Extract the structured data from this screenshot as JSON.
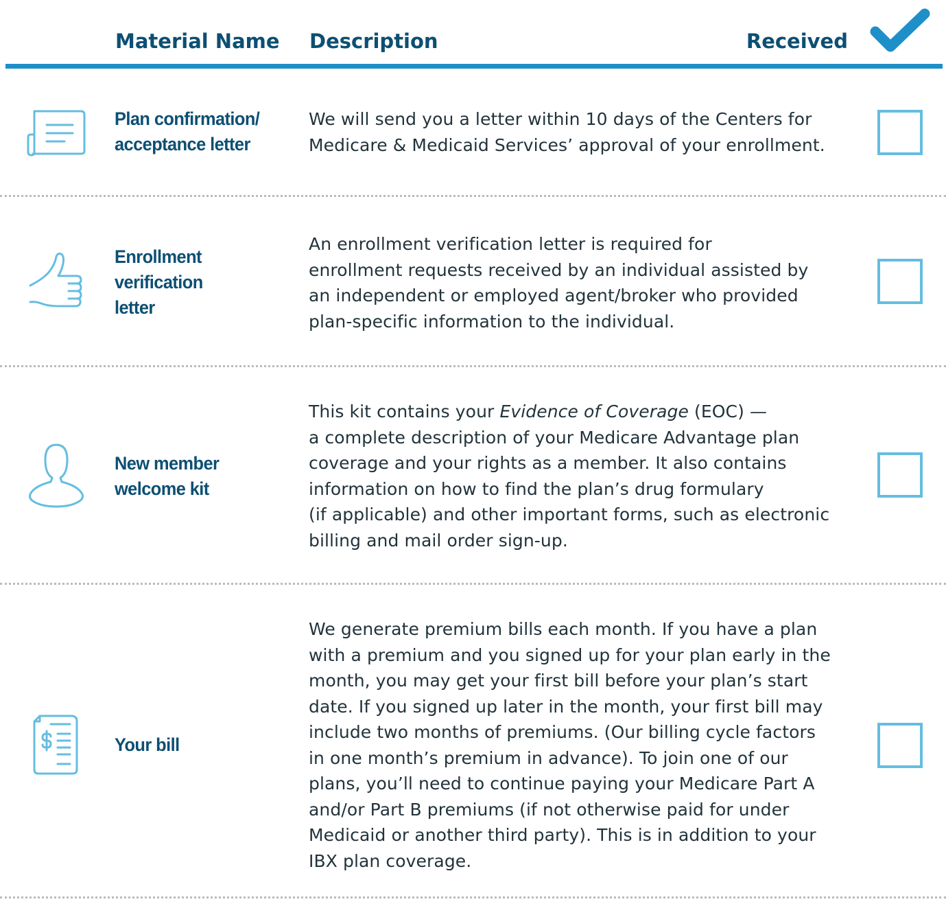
{
  "header": {
    "material_name": "Material Name",
    "description": "Description",
    "received": "Received",
    "check_icon": "checkmark-icon",
    "accent_color": "#1e8fc9",
    "heading_color": "#0c4f73"
  },
  "rows": [
    {
      "icon": "letter-icon",
      "name_lines": [
        "Plan confirmation/",
        "acceptance letter"
      ],
      "description_lines": [
        "We will send you a letter within 10 days of the Centers for",
        "Medicare & Medicaid Services’ approval of your enrollment."
      ],
      "received": false
    },
    {
      "icon": "thumbs-up-icon",
      "name_lines": [
        "Enrollment",
        "verification",
        "letter"
      ],
      "description_lines": [
        "An enrollment verification letter is required for",
        "enrollment requests received by an individual assisted by",
        "an independent or employed agent/broker who provided",
        "plan-specific information to the individual."
      ],
      "received": false
    },
    {
      "icon": "person-icon",
      "name_lines": [
        "New member",
        "welcome kit"
      ],
      "description_lines": [
        "This kit contains your ",
        "a complete description of your Medicare Advantage plan",
        "coverage and your rights as a member. It also contains",
        "information on how to find the plan’s drug formulary",
        "(if applicable) and other important forms, such as electronic",
        "billing and mail order sign-up."
      ],
      "description_italic": "Evidence of Coverage",
      "description_after_italic": " (EOC) —",
      "received": false
    },
    {
      "icon": "bill-icon",
      "name_lines": [
        "Your bill"
      ],
      "description_lines": [
        "We generate premium bills each month. If you have a plan",
        "with a premium and you signed up for your plan early in the",
        "month, you may get your first bill before your plan’s start",
        "date. If you signed up later in the month, your first bill may",
        "include two months of premiums. (Our billing cycle factors",
        "in one month’s premium in advance). To join one of our",
        "plans, you’ll need to continue paying your Medicare Part A",
        "and/or Part B premiums (if not otherwise paid for under",
        "Medicaid or another third party). This is in addition to your",
        "IBX plan coverage."
      ],
      "received": false
    }
  ]
}
